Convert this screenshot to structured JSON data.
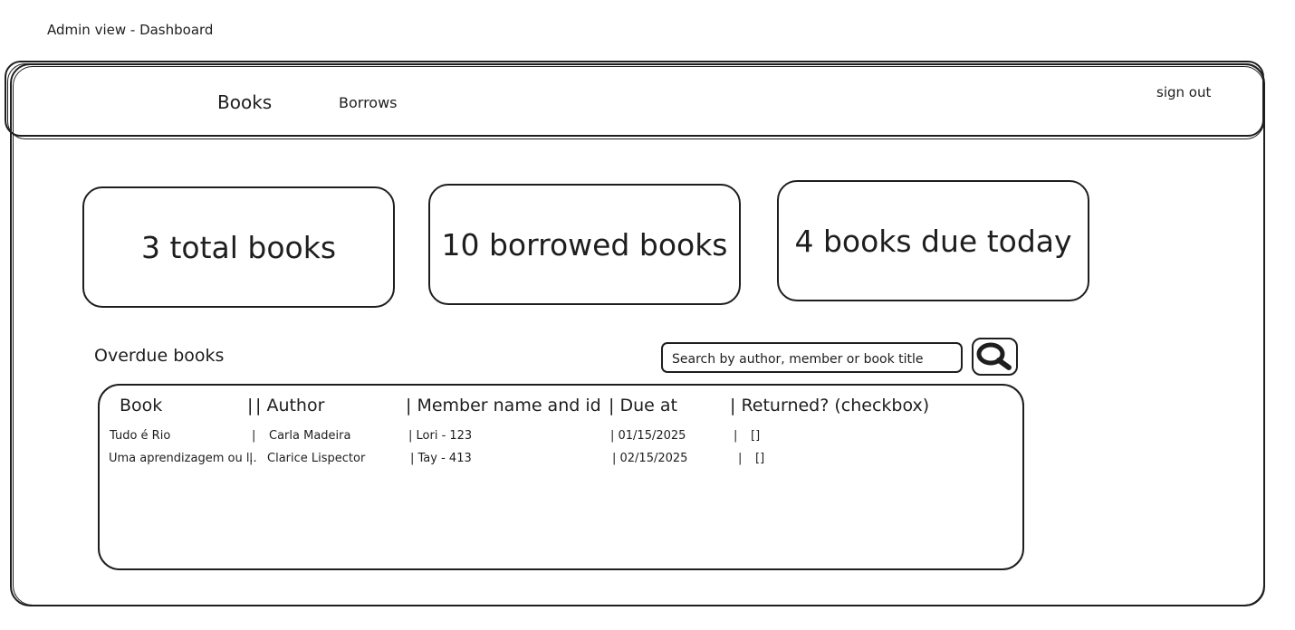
{
  "page_caption": "Admin view - Dashboard",
  "nav": {
    "books": "Books",
    "borrows": "Borrows",
    "sign_out": "sign out"
  },
  "stats": {
    "total": "3 total books",
    "borrowed": "10 borrowed books",
    "due_today": "4 books due today"
  },
  "overdue": {
    "title": "Overdue books",
    "search_placeholder": "Search by author, member or book title",
    "search_icon": "magnifier-icon",
    "columns": [
      "Book",
      "| Author",
      "| Member name and id",
      "| Due at",
      "| Returned? (checkbox)"
    ],
    "rows": [
      [
        "Tudo é Rio",
        "|",
        "Carla Madeira",
        "| Lori - 123",
        "| 01/15/2025",
        "|",
        "[]"
      ],
      [
        "Uma aprendizagem ou l..",
        "|",
        "Clarice Lispector",
        "| Tay - 413",
        "| 02/15/2025",
        "|",
        "[]"
      ]
    ],
    "header_separator": "|"
  }
}
